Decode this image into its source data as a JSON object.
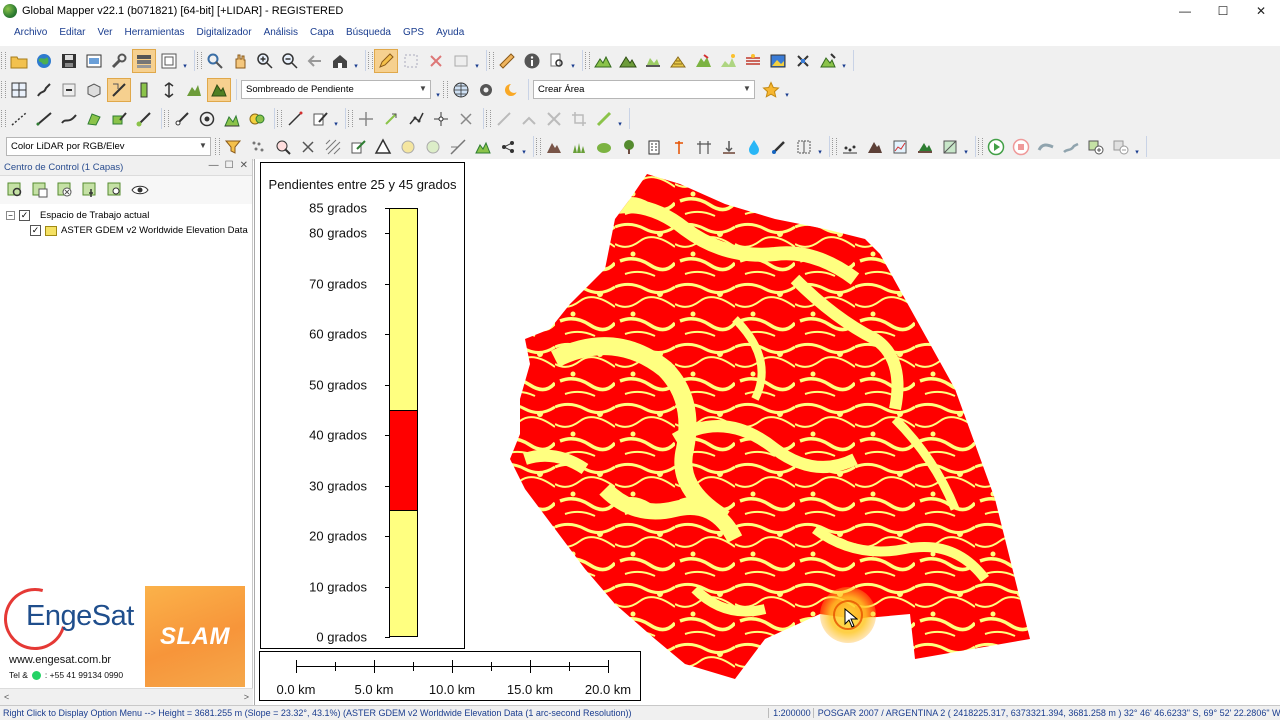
{
  "window": {
    "title": "Global Mapper  v22.1 (b071821) [64-bit] [+LIDAR] - REGISTERED",
    "minimize": "—",
    "maximize": "☐",
    "close": "✕"
  },
  "menu": [
    "Archivo",
    "Editar",
    "Ver",
    "Herramientas",
    "Digitalizador",
    "Análisis",
    "Capa",
    "Búsqueda",
    "GPS",
    "Ayuda"
  ],
  "toolbar": {
    "shader_select": "Sombreado de Pendiente",
    "create_select": "Crear Área",
    "lidar_color_select": "Color LiDAR por RGB/Elev"
  },
  "control_center": {
    "title": "Centro de Control (1 Capas)",
    "workspace_label": "Espacio de Trabajo actual",
    "layer_label": "ASTER GDEM v2 Worldwide Elevation Data"
  },
  "branding": {
    "engesat": "EngeSat",
    "url": "www.engesat.com.br",
    "tel_prefix": "Tel &",
    "phone": ": +55 41 99134 0990",
    "slam": "SLAM"
  },
  "legend": {
    "title": "Pendientes entre 25 y 45 grados",
    "labels": [
      "85 grados",
      "80 grados",
      "70 grados",
      "60 grados",
      "50 grados",
      "40 grados",
      "30 grados",
      "20 grados",
      "10 grados",
      "0 grados"
    ],
    "range_low": 25,
    "range_high": 45,
    "color_in_range": "#ff0000",
    "color_out_range": "#ffff80"
  },
  "scale_bar": {
    "labels": [
      "0.0 km",
      "5.0 km",
      "10.0 km",
      "15.0 km",
      "20.0 km"
    ]
  },
  "status": {
    "left": "Right Click to Display Option Menu --> Height = 3681.255 m (Slope = 23.32°, 43.1%) (ASTER GDEM v2 Worldwide Elevation Data (1 arc-second Resolution))",
    "scale": "1:200000",
    "projection": "POSGAR 2007 / ARGENTINA 2 ( 2418225.317, 6373321.394, 3681.258 m )  32° 46' 46.6233\" S, 69° 52' 22.2806\" W"
  },
  "colors": {
    "slope_red": "#ff0000",
    "slope_yellow": "#ffff80",
    "menu_text": "#1a3d8f"
  }
}
